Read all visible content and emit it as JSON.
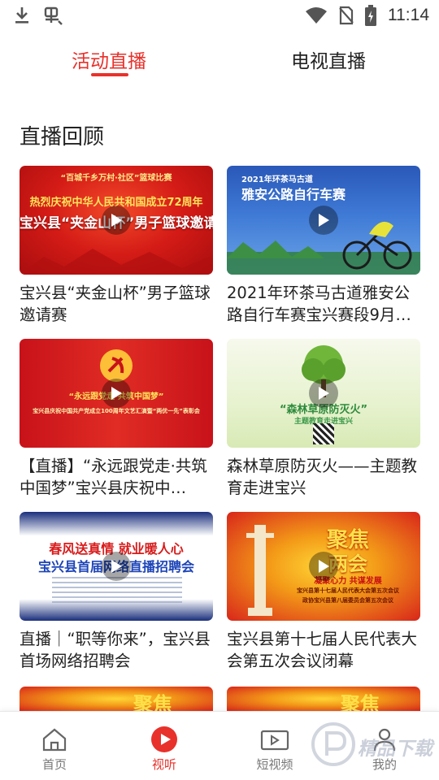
{
  "status_bar": {
    "time": "11:14",
    "left_icons": [
      "download-icon",
      "bug-icon"
    ],
    "right_icons": [
      "wifi-icon",
      "no-sim-icon",
      "battery-charging-icon"
    ]
  },
  "top_tabs": [
    {
      "label": "活动直播",
      "active": true
    },
    {
      "label": "电视直播",
      "active": false
    }
  ],
  "section": {
    "title": "直播回顾"
  },
  "videos": [
    {
      "title": "宝兴县“夹金山杯”男子篮球邀请赛",
      "thumb_text": [
        "“百城千乡万村·社区”篮球比赛",
        "热烈庆祝中华人民共和国成立72周年",
        "宝兴县“夹金山杯”男子篮球邀请赛"
      ]
    },
    {
      "title": "2021年环茶马古道雅安公路自行车赛宝兴赛段9月…",
      "thumb_text": [
        "2021年环茶马古道",
        "雅安公路自行车赛"
      ]
    },
    {
      "title": "【直播】“永远跟党走·共筑中国梦”宝兴县庆祝中…",
      "thumb_text": [
        "“永远跟党走·共筑中国梦”",
        "宝兴县庆祝中国共产党成立100周年文艺汇演暨“两优一先”表彰会"
      ]
    },
    {
      "title": "森林草原防灭火——主题教育走进宝兴",
      "thumb_text": [
        "“森林草原防灭火”",
        "主题教育走进宝兴"
      ]
    },
    {
      "title": "直播｜“职等你来”，宝兴县首场网络招聘会",
      "thumb_text": [
        "春风送真情 就业暖人心",
        "宝兴县首届网络直播招聘会"
      ]
    },
    {
      "title": "宝兴县第十七届人民代表大会第五次会议闭幕",
      "thumb_text": [
        "聚焦",
        "两会",
        "凝聚心力 共谋发展",
        "宝兴县第十七届人民代表大会第五次会议",
        "政协宝兴县第八届委员会第五次会议"
      ]
    }
  ],
  "partial_row_text": [
    "聚焦",
    "聚焦"
  ],
  "bottom_nav": [
    {
      "label": "首页",
      "icon": "home-icon",
      "active": false
    },
    {
      "label": "视听",
      "icon": "play-circle-icon",
      "active": true
    },
    {
      "label": "短视频",
      "icon": "video-camera-icon",
      "active": false
    },
    {
      "label": "我的",
      "icon": "user-icon",
      "active": false
    }
  ],
  "watermark": {
    "text": "精品下载"
  },
  "colors": {
    "accent": "#e8312b",
    "text": "#222222",
    "nav_inactive": "#777777"
  }
}
